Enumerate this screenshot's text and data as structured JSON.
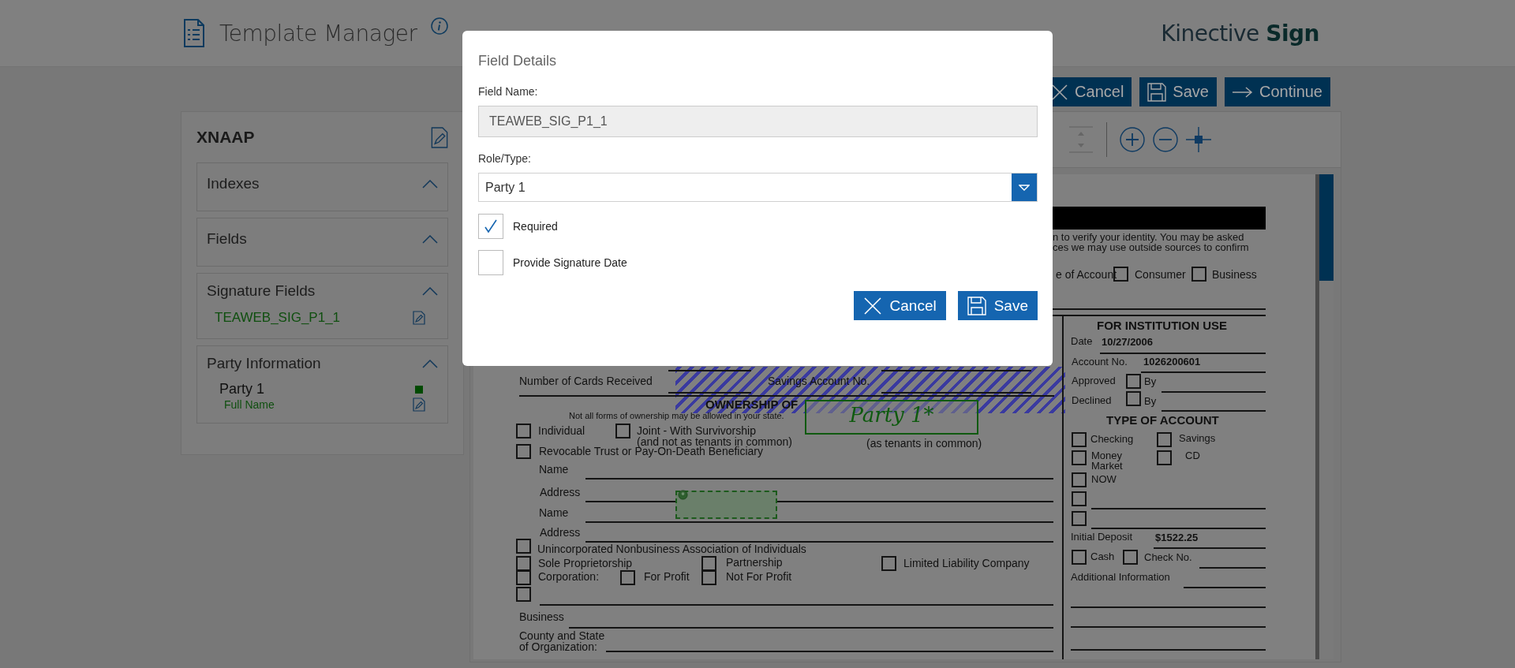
{
  "header": {
    "title": "Template Manager",
    "brand": "Kinective",
    "brand_strong": "Sign"
  },
  "actions": [
    {
      "kind": "cancel",
      "label": "Cancel"
    },
    {
      "kind": "save",
      "label": "Save"
    },
    {
      "kind": "continue",
      "label": "Continue"
    }
  ],
  "sidebar": {
    "title": "XNAAP",
    "sections": [
      {
        "title": "Indexes",
        "expanded": true
      },
      {
        "title": "Fields",
        "expanded": true
      },
      {
        "title": "Signature Fields",
        "expanded": true,
        "items": [
          {
            "label": "TEAWEB_SIG_P1_1"
          }
        ]
      },
      {
        "title": "Party Information",
        "expanded": true,
        "parties": [
          {
            "name": "Party 1",
            "color": "#004a00",
            "fields": [
              {
                "label": "Full Name"
              }
            ]
          }
        ]
      }
    ]
  },
  "document": {
    "texts": [
      "n to verify your identity. You may be asked",
      "ces we may use outside sources to confirm",
      "e of Account",
      "Consumer",
      "Business",
      "FOR INSTITUTION USE",
      "Date",
      "10/27/2006",
      "Account No.",
      "1026200601",
      "Approved",
      "By",
      "Declined",
      "By",
      "TYPE OF ACCOUNT",
      "Checking",
      "Savings",
      "Money Market",
      "CD",
      "NOW",
      "Initial Deposit",
      "$1522.25",
      "Cash",
      "Check No.",
      "Additional Information",
      "Number of Cards Received",
      "Savings Account No.",
      "OWNERSHIP OF",
      "Not all forms of ownership may be allowed in your state.",
      "Individual",
      "Joint - With Survivorship",
      "(and not as tenants in common)",
      "(as tenants in common)",
      "Revocable Trust or Pay-On-Death Beneficiary",
      "Name",
      "Address",
      "Name",
      "Address",
      "Unincorporated Nonbusiness Association of Individuals",
      "Sole Proprietorship",
      "Partnership",
      "Limited Liability Company",
      "Corporation:",
      "For Profit",
      "Not For Profit",
      "Business",
      "County and State",
      "of Organization:"
    ],
    "checkboxes": [
      {
        "checked": false
      },
      {
        "checked": false
      },
      {
        "checked": false
      },
      {
        "checked": false
      },
      {
        "checked": false
      },
      {
        "checked": false
      },
      {
        "checked": false
      },
      {
        "checked": false
      },
      {
        "checked": false
      },
      {
        "checked": false
      },
      {
        "checked": false
      },
      {
        "checked": false
      },
      {
        "checked": false
      },
      {
        "checked": false
      },
      {
        "checked": false
      },
      {
        "checked": false
      },
      {
        "checked": false
      },
      {
        "checked": false
      },
      {
        "checked": false
      },
      {
        "checked": false
      },
      {
        "checked": false
      },
      {
        "checked": false
      },
      {
        "checked": false
      },
      {
        "checked": false
      }
    ],
    "signature_box": {
      "label": "Party 1*"
    }
  },
  "dialog": {
    "title": "Field Details",
    "fields": [
      {
        "label": "Field Name:",
        "kind": "text",
        "value": "TEAWEB_SIG_P1_1"
      },
      {
        "label": "Role/Type:",
        "kind": "select",
        "value": "Party 1"
      }
    ],
    "options": [
      {
        "label": "Required",
        "checked": true
      },
      {
        "label": "Provide Signature Date",
        "checked": false
      }
    ],
    "buttons": [
      {
        "kind": "cancel",
        "label": "Cancel"
      },
      {
        "kind": "save",
        "label": "Save"
      }
    ]
  }
}
